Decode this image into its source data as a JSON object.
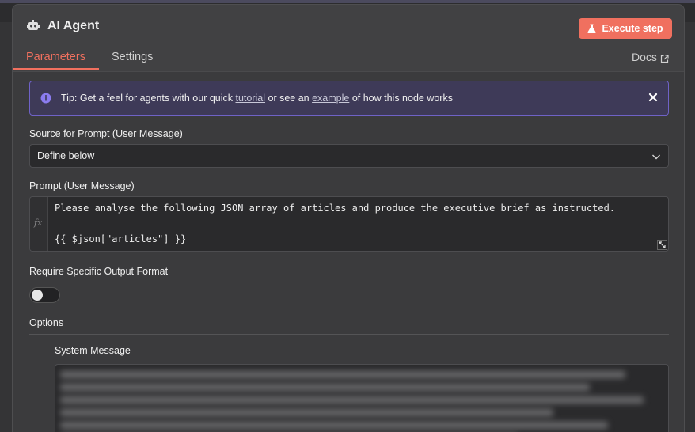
{
  "node": {
    "title": "AI Agent",
    "execute_label": "Execute step"
  },
  "tabs": [
    {
      "label": "Parameters",
      "active": true
    },
    {
      "label": "Settings",
      "active": false
    }
  ],
  "docs_label": "Docs",
  "tip": {
    "prefix": "Tip: Get a feel for agents with our quick ",
    "link1": "tutorial",
    "middle": " or see an ",
    "link2": "example",
    "suffix": " of how this node works"
  },
  "fields": {
    "source_label": "Source for Prompt (User Message)",
    "source_value": "Define below",
    "prompt_label": "Prompt (User Message)",
    "prompt_line1": "Please analyse the following JSON array of articles and produce the executive brief as instructed.",
    "prompt_line2": "{{ $json[\"articles\"] }}",
    "prompt_fx": "fx",
    "output_format_label": "Require Specific Output Format",
    "output_format_enabled": false,
    "options_label": "Options",
    "system_message_label": "System Message"
  },
  "colors": {
    "accent": "#f0705f",
    "tip_border": "#6f62c7",
    "panel_bg": "#414143"
  }
}
